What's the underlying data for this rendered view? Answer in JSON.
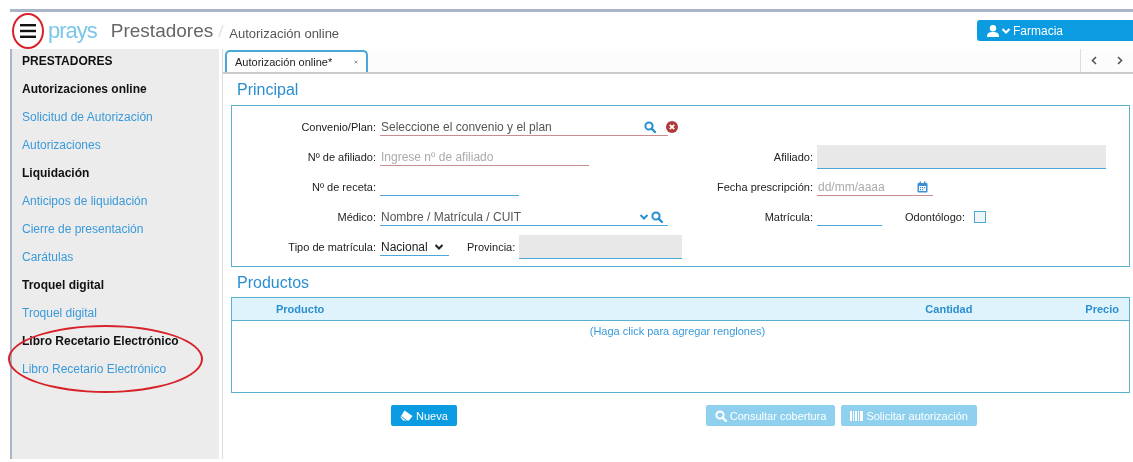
{
  "header": {
    "menu_button": {
      "circled": true
    },
    "logo": "prays",
    "app_title": "Prestadores",
    "breadcrumb": "Autorización online",
    "user_button": "Farmacia"
  },
  "sidebar": {
    "title": "PRESTADORES",
    "sections": [
      {
        "title": "Autorizaciones online",
        "circled": false,
        "items": [
          {
            "label": "Solicitud de Autorización"
          },
          {
            "label": "Autorizaciones"
          }
        ]
      },
      {
        "title": "Liquidación",
        "circled": false,
        "items": [
          {
            "label": "Anticipos de liquidación"
          },
          {
            "label": "Cierre de presentación"
          },
          {
            "label": "Carátulas"
          }
        ]
      },
      {
        "title": "Troquel digital",
        "circled": false,
        "items": [
          {
            "label": "Troquel digital"
          }
        ]
      },
      {
        "title": "Libro Recetario Electrónico",
        "circled": true,
        "items": [
          {
            "label": "Libro Recetario Electrónico"
          }
        ]
      }
    ]
  },
  "tabs": [
    {
      "label": "Autorización online*",
      "selected": true
    }
  ],
  "principal": {
    "title": "Principal",
    "rows": [
      {
        "left": [
          {
            "kind": "lookup",
            "label": "Convenio/Plan:",
            "value": "Seleccione el convenio y el plan",
            "invalid": true
          }
        ],
        "right": []
      },
      {
        "left": [
          {
            "kind": "text",
            "label": "Nº de afiliado:",
            "placeholder": "Ingrese nº de afiliado",
            "invalid": true
          }
        ],
        "right": [
          {
            "kind": "text",
            "label": "Afiliado:",
            "disabled": true
          }
        ]
      },
      {
        "left": [
          {
            "kind": "text",
            "label": "Nº de receta:"
          }
        ],
        "right": [
          {
            "kind": "date",
            "label": "Fecha prescripción:",
            "placeholder": "dd/mm/aaaa",
            "invalid": true
          }
        ]
      },
      {
        "left": [
          {
            "kind": "combo",
            "label": "Médico:",
            "value": "Nombre / Matrícula / CUIT"
          }
        ],
        "right": [
          {
            "kind": "text",
            "label": "Matrícula:"
          },
          {
            "kind": "checkbox",
            "label": "Odontólogo:",
            "checked": false
          }
        ]
      },
      {
        "left": [
          {
            "kind": "select",
            "label": "Tipo de matrícula:",
            "value": "Nacional"
          },
          {
            "kind": "text",
            "label": "Provincia:",
            "disabled": true
          }
        ],
        "right": []
      }
    ]
  },
  "productos": {
    "title": "Productos",
    "columns": [
      {
        "label": "Producto"
      },
      {
        "label": "Cantidad"
      },
      {
        "label": "Precio"
      }
    ],
    "empty_message": "(Haga click para agregar renglones)"
  },
  "buttons": [
    {
      "kind": "new",
      "label": "Nueva",
      "disabled": false
    },
    {
      "kind": "search",
      "label": "Consultar cobertura",
      "disabled": true
    },
    {
      "kind": "barcode",
      "label": "Solicitar autorización",
      "disabled": true
    }
  ]
}
